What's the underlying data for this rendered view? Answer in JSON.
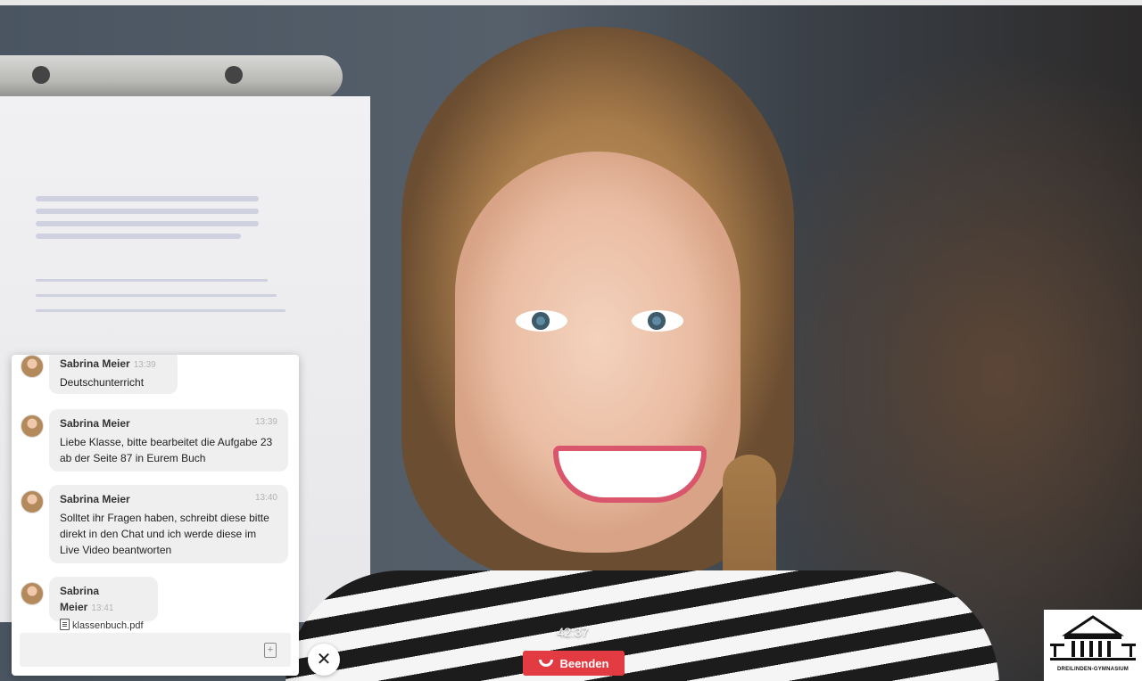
{
  "chat": {
    "messages": [
      {
        "sender": "Sabrina Meier",
        "time": "13:39",
        "text": "Deutschunterricht"
      },
      {
        "sender": "Sabrina Meier",
        "time": "13:39",
        "text": "Liebe Klasse, bitte bearbeitet die Aufgabe 23 ab der Seite 87 in Eurem Buch"
      },
      {
        "sender": "Sabrina Meier",
        "time": "13:40",
        "text": "Solltet ihr Fragen haben, schreibt diese bitte direkt in den Chat und ich werde diese im Live Video beantworten"
      },
      {
        "sender": "Sabrina Meier",
        "time": "13:41",
        "file": "klassenbuch.pdf"
      }
    ],
    "input": {
      "value": "",
      "placeholder": ""
    }
  },
  "call": {
    "timer": "42:37",
    "end_label": "Beenden",
    "end_color": "#e23b42"
  },
  "logo": {
    "text": "DREILINDEN-GYMNASIUM"
  },
  "icons": {
    "close": "close-icon",
    "end_call": "phone-hangup-icon",
    "attach": "file-attach-icon",
    "file": "document-icon"
  }
}
